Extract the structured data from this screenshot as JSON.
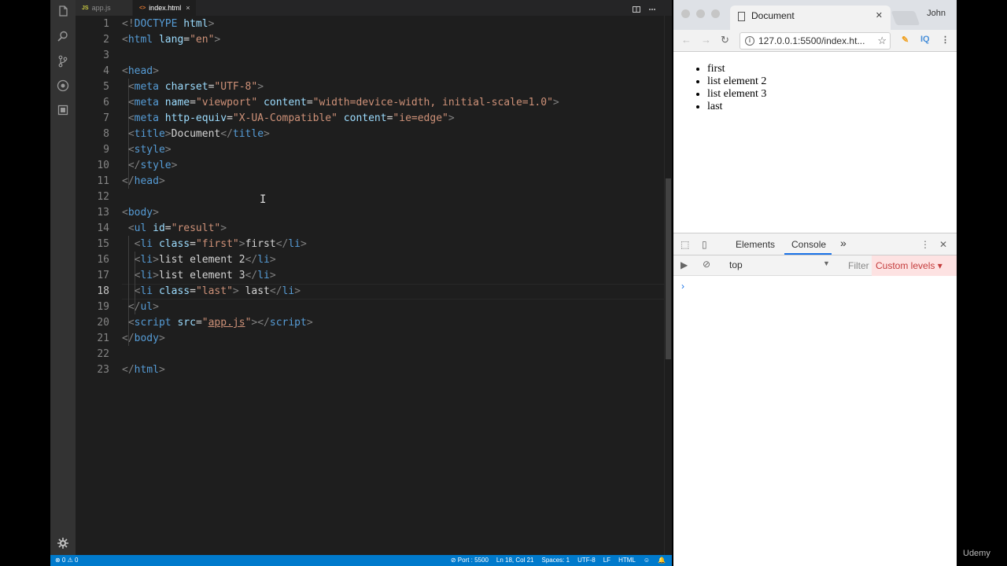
{
  "editor": {
    "tabs": [
      {
        "icon_text": "JS",
        "label": "app.js",
        "active": false
      },
      {
        "icon_text": "<>",
        "label": "index.html",
        "active": true
      }
    ],
    "tab_close_glyph": "×",
    "activity_icons": [
      "files-icon",
      "search-icon",
      "source-control-icon",
      "debug-icon",
      "extensions-icon",
      "settings-icon"
    ],
    "lines": [
      "1",
      "2",
      "3",
      "4",
      "5",
      "6",
      "7",
      "8",
      "9",
      "10",
      "11",
      "12",
      "13",
      "14",
      "15",
      "16",
      "17",
      "18",
      "19",
      "20",
      "21",
      "22",
      "23"
    ],
    "current_line": 18,
    "status": {
      "problems": "⊗ 0 ⚠ 0",
      "port": "⊘ Port : 5500",
      "position": "Ln 18, Col 21",
      "spaces": "Spaces: 1",
      "encoding": "UTF-8",
      "eol": "LF",
      "language": "HTML"
    }
  },
  "browser": {
    "tab_title": "Document",
    "profile": "John",
    "url": "127.0.0.1:5500/index.ht...",
    "list_items": [
      "first",
      "list element 2",
      "list element 3",
      "last"
    ],
    "devtools": {
      "tabs": [
        "Elements",
        "Console"
      ],
      "active_tab": "Console",
      "more": "»",
      "context": "top",
      "filter_placeholder": "Filter",
      "levels": "Custom levels ▾",
      "prompt": "›"
    },
    "extensions": [
      "IQ"
    ]
  },
  "watermark": "Udemy",
  "colors": {
    "editor_bg": "#1e1e1e",
    "status_bar": "#007acc",
    "tag": "#569cd6",
    "attribute": "#9cdcfe",
    "string": "#ce9178"
  }
}
